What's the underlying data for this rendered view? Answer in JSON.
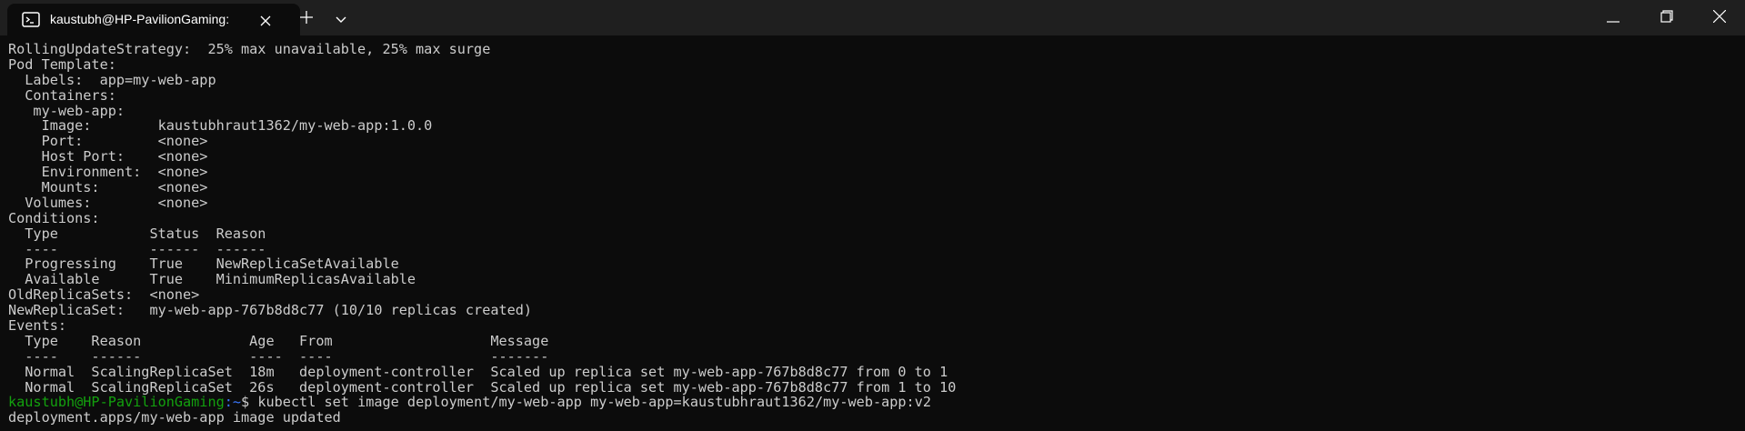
{
  "window": {
    "tab_title": "kaustubh@HP-PavilionGaming:",
    "tab_icon": "terminal-icon",
    "buttons": [
      "plus-icon",
      "chevron-down-icon",
      "minimize-icon",
      "maximize-icon",
      "close-icon"
    ]
  },
  "terminal": {
    "lines": [
      "RollingUpdateStrategy:  25% max unavailable, 25% max surge",
      "Pod Template:",
      "  Labels:  app=my-web-app",
      "  Containers:",
      "   my-web-app:",
      "    Image:        kaustubhraut1362/my-web-app:1.0.0",
      "    Port:         <none>",
      "    Host Port:    <none>",
      "    Environment:  <none>",
      "    Mounts:       <none>",
      "  Volumes:        <none>",
      "Conditions:",
      "  Type           Status  Reason",
      "  ----           ------  ------",
      "  Progressing    True    NewReplicaSetAvailable",
      "  Available      True    MinimumReplicasAvailable",
      "OldReplicaSets:  <none>",
      "NewReplicaSet:   my-web-app-767b8d8c77 (10/10 replicas created)",
      "Events:",
      "  Type    Reason             Age   From                   Message",
      "  ----    ------             ----  ----                   -------",
      "  Normal  ScalingReplicaSet  18m   deployment-controller  Scaled up replica set my-web-app-767b8d8c77 from 0 to 1",
      "  Normal  ScalingReplicaSet  26s   deployment-controller  Scaled up replica set my-web-app-767b8d8c77 from 1 to 10"
    ],
    "prompt": {
      "user": "kaustubh@HP-PavilionGaming",
      "path": ":~",
      "symbol": "$ ",
      "command": "kubectl set image deployment/my-web-app my-web-app=kaustubhraut1362/my-web-app:v2"
    },
    "output": "deployment.apps/my-web-app image updated"
  },
  "colors": {
    "background": "#0c0c0c",
    "titlebar": "#1f1f1f",
    "text": "#cccccc",
    "prompt_user": "#13a10e",
    "prompt_path": "#3b78ff"
  }
}
